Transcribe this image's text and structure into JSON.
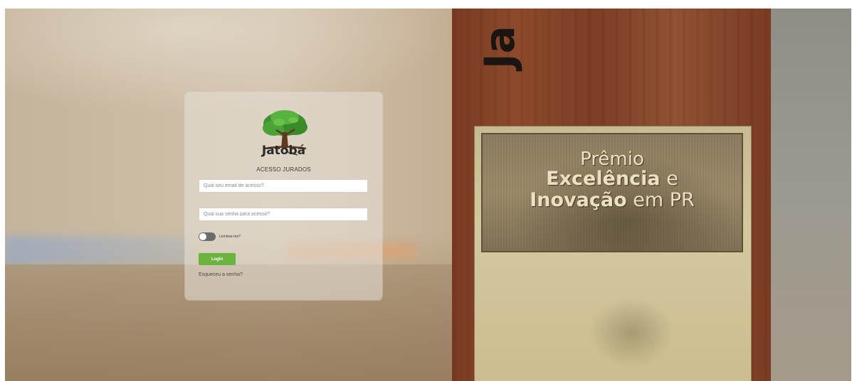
{
  "background": {
    "wood_letters": "Ja"
  },
  "plaque": {
    "line1": "Prêmio",
    "line2_bold": "Excelência",
    "line2_rest": " e",
    "line3_bold": "Inovação",
    "line3_rest": " em PR"
  },
  "login": {
    "logo_text": "Jatobá",
    "subtitle": "ACESSO JURADOS",
    "email_placeholder": "Qual seu email de acesso?",
    "password_placeholder": "Qual sua senha para acesso?",
    "remember_label": "Lembrar-me?",
    "login_button": "Login",
    "forgot_link": "Esqueceu a senha?"
  },
  "colors": {
    "login_button": "#6bb33e",
    "toggle_off": "#6b6b6b"
  },
  "icons": {
    "logo": "tree-icon",
    "remember": "toggle-switch"
  }
}
